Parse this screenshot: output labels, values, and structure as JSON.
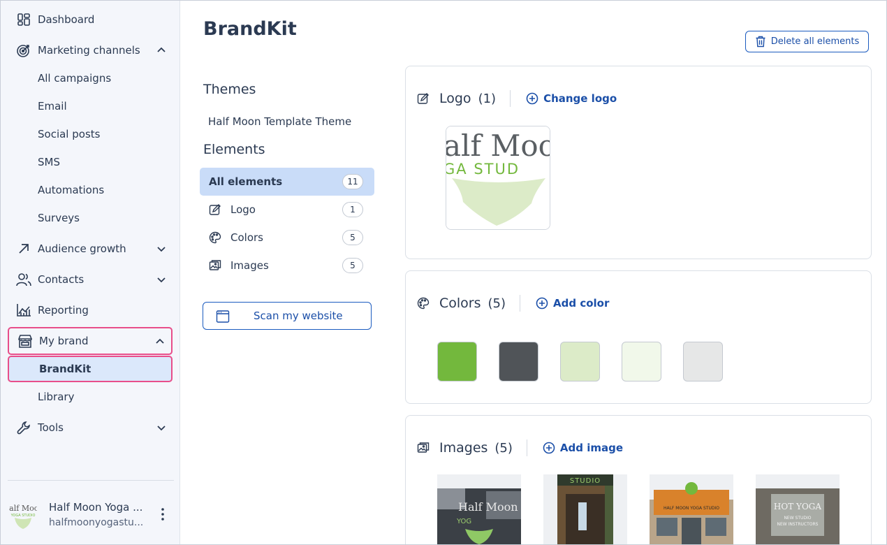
{
  "sidebar": {
    "dashboard": "Dashboard",
    "marketing_channels": "Marketing channels",
    "marketing_sub": [
      "All campaigns",
      "Email",
      "Social posts",
      "SMS",
      "Automations",
      "Surveys"
    ],
    "audience_growth": "Audience growth",
    "contacts": "Contacts",
    "reporting": "Reporting",
    "my_brand": "My brand",
    "brand_sub": [
      "BrandKit",
      "Library"
    ],
    "tools": "Tools",
    "account": {
      "name": "Half Moon Yoga ...",
      "email": "halfmoonyogastu..."
    }
  },
  "main": {
    "title": "BrandKit",
    "delete_all": "Delete all elements",
    "themes_heading": "Themes",
    "theme_name": "Half Moon Template Theme",
    "elements_heading": "Elements",
    "elements": [
      {
        "label": "All elements",
        "count": "11"
      },
      {
        "label": "Logo",
        "count": "1"
      },
      {
        "label": "Colors",
        "count": "5"
      },
      {
        "label": "Images",
        "count": "5"
      }
    ],
    "scan_button": "Scan my website",
    "logo_card": {
      "title": "Logo",
      "count": "(1)",
      "action": "Change logo"
    },
    "colors_card": {
      "title": "Colors",
      "count": "(5)",
      "action": "Add color"
    },
    "images_card": {
      "title": "Images",
      "count": "(5)",
      "action": "Add image"
    },
    "colors": [
      "#73b83d",
      "#505458",
      "#dcebc8",
      "#f1f8ea",
      "#e6e7e7"
    ],
    "logo_text": {
      "line1": "alf Moo",
      "line2": "GA STUD"
    },
    "sidebar_logo_text": {
      "line1": "Half Moon",
      "line2": "YOGA STUDIO"
    },
    "image_texts": {
      "img1": "Half Moon",
      "img1b": "YOG",
      "img2": "STUDIO",
      "img3": "HALF MOON YOGA STUDIO",
      "img4a": "HOT YOGA",
      "img4b": "NEW STUDIO",
      "img4c": "NEW INSTRUCTORS"
    }
  },
  "colors": {
    "accent": "#1b4fa8",
    "highlight": "#e84e8a",
    "active_bg": "#dbe8fb",
    "brand_green": "#73b83d"
  }
}
